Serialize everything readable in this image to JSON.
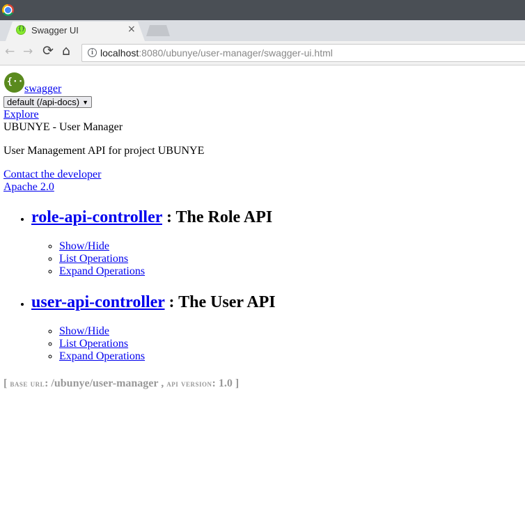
{
  "browser": {
    "tab_title": "Swagger UI",
    "tab_close": "×",
    "url_host": "localhost",
    "url_rest": ":8080/ubunye/user-manager/swagger-ui.html",
    "back_icon": "←",
    "forward_icon": "→",
    "reload_icon": "⟳",
    "home_icon": "⌂",
    "info_icon": "i"
  },
  "header": {
    "logo_glyph": "{···}",
    "logo_text": "swagger",
    "spec_select": "default (/api-docs)",
    "explore": "Explore"
  },
  "info": {
    "title": "UBUNYE - User Manager",
    "description": "User Management API for project UBUNYE",
    "contact": "Contact the developer",
    "license": "Apache 2.0"
  },
  "resources": [
    {
      "name": "role-api-controller",
      "description": ": The Role API",
      "ops": [
        "Show/Hide",
        "List Operations",
        "Expand Operations"
      ]
    },
    {
      "name": "user-api-controller",
      "description": ": The User API",
      "ops": [
        "Show/Hide",
        "List Operations",
        "Expand Operations"
      ]
    }
  ],
  "footer": {
    "open": "[",
    "base_url_label": "base url",
    "base_url": ": /ubunye/user-manager",
    "sep": " ,",
    "api_version_label": "api version",
    "api_version": ": 1.0",
    "close": "]"
  }
}
